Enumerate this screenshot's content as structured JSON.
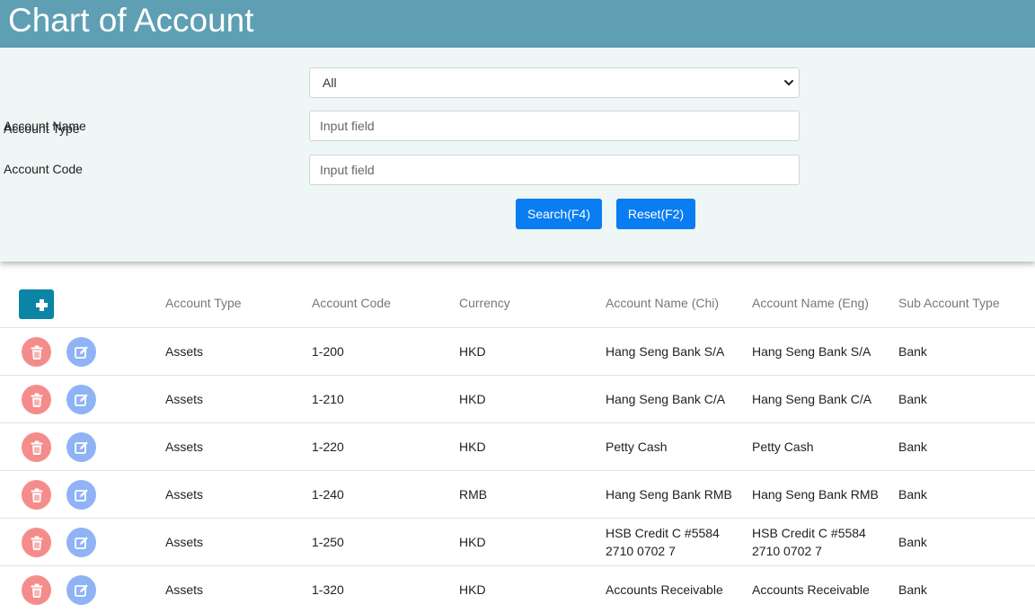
{
  "page": {
    "title": "Chart of Account"
  },
  "filters": {
    "account_type_label": "Account Type",
    "account_type_value": "All",
    "account_name_label": "Account Name",
    "account_name_placeholder": "Input field",
    "account_code_label": "Account Code",
    "account_code_placeholder": "Input field",
    "search_label": "Search(F4)",
    "reset_label": "Reset(F2)"
  },
  "table": {
    "headers": [
      "Account Type",
      "Account Code",
      "Currency",
      "Account Name (Chi)",
      "Account Name (Eng)",
      "Sub Account Type"
    ],
    "rows": [
      [
        "Assets",
        "1-200",
        "HKD",
        "Hang Seng Bank S/A",
        "Hang Seng Bank S/A",
        "Bank"
      ],
      [
        "Assets",
        "1-210",
        "HKD",
        "Hang Seng Bank C/A",
        "Hang Seng Bank C/A",
        "Bank"
      ],
      [
        "Assets",
        "1-220",
        "HKD",
        "Petty Cash",
        "Petty Cash",
        "Bank"
      ],
      [
        "Assets",
        "1-240",
        "RMB",
        "Hang Seng Bank RMB",
        "Hang Seng Bank RMB",
        "Bank"
      ],
      [
        "Assets",
        "1-250",
        "HKD",
        "HSB Credit C #5584 2710 0702 7",
        "HSB Credit C #5584 2710 0702 7",
        "Bank"
      ],
      [
        "Assets",
        "1-320",
        "HKD",
        "Accounts Receivable",
        "Accounts Receivable",
        "Bank"
      ]
    ]
  },
  "icons": {
    "add": "plus-icon",
    "delete": "trash-icon",
    "edit": "edit-icon",
    "select": "chevron-down-icon"
  },
  "colors": {
    "header_bg": "#5f9fb3",
    "filter_bg": "#eef7f6",
    "primary": "#0a7df2",
    "add": "#0b84a5",
    "delete": "#f58c8c",
    "edit": "#8fb3f5"
  }
}
